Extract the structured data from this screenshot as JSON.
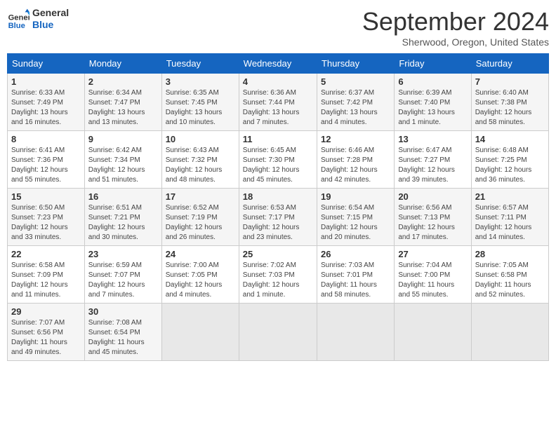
{
  "header": {
    "logo_line1": "General",
    "logo_line2": "Blue",
    "month_year": "September 2024",
    "location": "Sherwood, Oregon, United States"
  },
  "weekdays": [
    "Sunday",
    "Monday",
    "Tuesday",
    "Wednesday",
    "Thursday",
    "Friday",
    "Saturday"
  ],
  "weeks": [
    [
      {
        "day": "1",
        "lines": [
          "Sunrise: 6:33 AM",
          "Sunset: 7:49 PM",
          "Daylight: 13 hours",
          "and 16 minutes."
        ]
      },
      {
        "day": "2",
        "lines": [
          "Sunrise: 6:34 AM",
          "Sunset: 7:47 PM",
          "Daylight: 13 hours",
          "and 13 minutes."
        ]
      },
      {
        "day": "3",
        "lines": [
          "Sunrise: 6:35 AM",
          "Sunset: 7:45 PM",
          "Daylight: 13 hours",
          "and 10 minutes."
        ]
      },
      {
        "day": "4",
        "lines": [
          "Sunrise: 6:36 AM",
          "Sunset: 7:44 PM",
          "Daylight: 13 hours",
          "and 7 minutes."
        ]
      },
      {
        "day": "5",
        "lines": [
          "Sunrise: 6:37 AM",
          "Sunset: 7:42 PM",
          "Daylight: 13 hours",
          "and 4 minutes."
        ]
      },
      {
        "day": "6",
        "lines": [
          "Sunrise: 6:39 AM",
          "Sunset: 7:40 PM",
          "Daylight: 13 hours",
          "and 1 minute."
        ]
      },
      {
        "day": "7",
        "lines": [
          "Sunrise: 6:40 AM",
          "Sunset: 7:38 PM",
          "Daylight: 12 hours",
          "and 58 minutes."
        ]
      }
    ],
    [
      {
        "day": "8",
        "lines": [
          "Sunrise: 6:41 AM",
          "Sunset: 7:36 PM",
          "Daylight: 12 hours",
          "and 55 minutes."
        ]
      },
      {
        "day": "9",
        "lines": [
          "Sunrise: 6:42 AM",
          "Sunset: 7:34 PM",
          "Daylight: 12 hours",
          "and 51 minutes."
        ]
      },
      {
        "day": "10",
        "lines": [
          "Sunrise: 6:43 AM",
          "Sunset: 7:32 PM",
          "Daylight: 12 hours",
          "and 48 minutes."
        ]
      },
      {
        "day": "11",
        "lines": [
          "Sunrise: 6:45 AM",
          "Sunset: 7:30 PM",
          "Daylight: 12 hours",
          "and 45 minutes."
        ]
      },
      {
        "day": "12",
        "lines": [
          "Sunrise: 6:46 AM",
          "Sunset: 7:28 PM",
          "Daylight: 12 hours",
          "and 42 minutes."
        ]
      },
      {
        "day": "13",
        "lines": [
          "Sunrise: 6:47 AM",
          "Sunset: 7:27 PM",
          "Daylight: 12 hours",
          "and 39 minutes."
        ]
      },
      {
        "day": "14",
        "lines": [
          "Sunrise: 6:48 AM",
          "Sunset: 7:25 PM",
          "Daylight: 12 hours",
          "and 36 minutes."
        ]
      }
    ],
    [
      {
        "day": "15",
        "lines": [
          "Sunrise: 6:50 AM",
          "Sunset: 7:23 PM",
          "Daylight: 12 hours",
          "and 33 minutes."
        ]
      },
      {
        "day": "16",
        "lines": [
          "Sunrise: 6:51 AM",
          "Sunset: 7:21 PM",
          "Daylight: 12 hours",
          "and 30 minutes."
        ]
      },
      {
        "day": "17",
        "lines": [
          "Sunrise: 6:52 AM",
          "Sunset: 7:19 PM",
          "Daylight: 12 hours",
          "and 26 minutes."
        ]
      },
      {
        "day": "18",
        "lines": [
          "Sunrise: 6:53 AM",
          "Sunset: 7:17 PM",
          "Daylight: 12 hours",
          "and 23 minutes."
        ]
      },
      {
        "day": "19",
        "lines": [
          "Sunrise: 6:54 AM",
          "Sunset: 7:15 PM",
          "Daylight: 12 hours",
          "and 20 minutes."
        ]
      },
      {
        "day": "20",
        "lines": [
          "Sunrise: 6:56 AM",
          "Sunset: 7:13 PM",
          "Daylight: 12 hours",
          "and 17 minutes."
        ]
      },
      {
        "day": "21",
        "lines": [
          "Sunrise: 6:57 AM",
          "Sunset: 7:11 PM",
          "Daylight: 12 hours",
          "and 14 minutes."
        ]
      }
    ],
    [
      {
        "day": "22",
        "lines": [
          "Sunrise: 6:58 AM",
          "Sunset: 7:09 PM",
          "Daylight: 12 hours",
          "and 11 minutes."
        ]
      },
      {
        "day": "23",
        "lines": [
          "Sunrise: 6:59 AM",
          "Sunset: 7:07 PM",
          "Daylight: 12 hours",
          "and 7 minutes."
        ]
      },
      {
        "day": "24",
        "lines": [
          "Sunrise: 7:00 AM",
          "Sunset: 7:05 PM",
          "Daylight: 12 hours",
          "and 4 minutes."
        ]
      },
      {
        "day": "25",
        "lines": [
          "Sunrise: 7:02 AM",
          "Sunset: 7:03 PM",
          "Daylight: 12 hours",
          "and 1 minute."
        ]
      },
      {
        "day": "26",
        "lines": [
          "Sunrise: 7:03 AM",
          "Sunset: 7:01 PM",
          "Daylight: 11 hours",
          "and 58 minutes."
        ]
      },
      {
        "day": "27",
        "lines": [
          "Sunrise: 7:04 AM",
          "Sunset: 7:00 PM",
          "Daylight: 11 hours",
          "and 55 minutes."
        ]
      },
      {
        "day": "28",
        "lines": [
          "Sunrise: 7:05 AM",
          "Sunset: 6:58 PM",
          "Daylight: 11 hours",
          "and 52 minutes."
        ]
      }
    ],
    [
      {
        "day": "29",
        "lines": [
          "Sunrise: 7:07 AM",
          "Sunset: 6:56 PM",
          "Daylight: 11 hours",
          "and 49 minutes."
        ]
      },
      {
        "day": "30",
        "lines": [
          "Sunrise: 7:08 AM",
          "Sunset: 6:54 PM",
          "Daylight: 11 hours",
          "and 45 minutes."
        ]
      },
      {
        "day": "",
        "lines": []
      },
      {
        "day": "",
        "lines": []
      },
      {
        "day": "",
        "lines": []
      },
      {
        "day": "",
        "lines": []
      },
      {
        "day": "",
        "lines": []
      }
    ]
  ]
}
